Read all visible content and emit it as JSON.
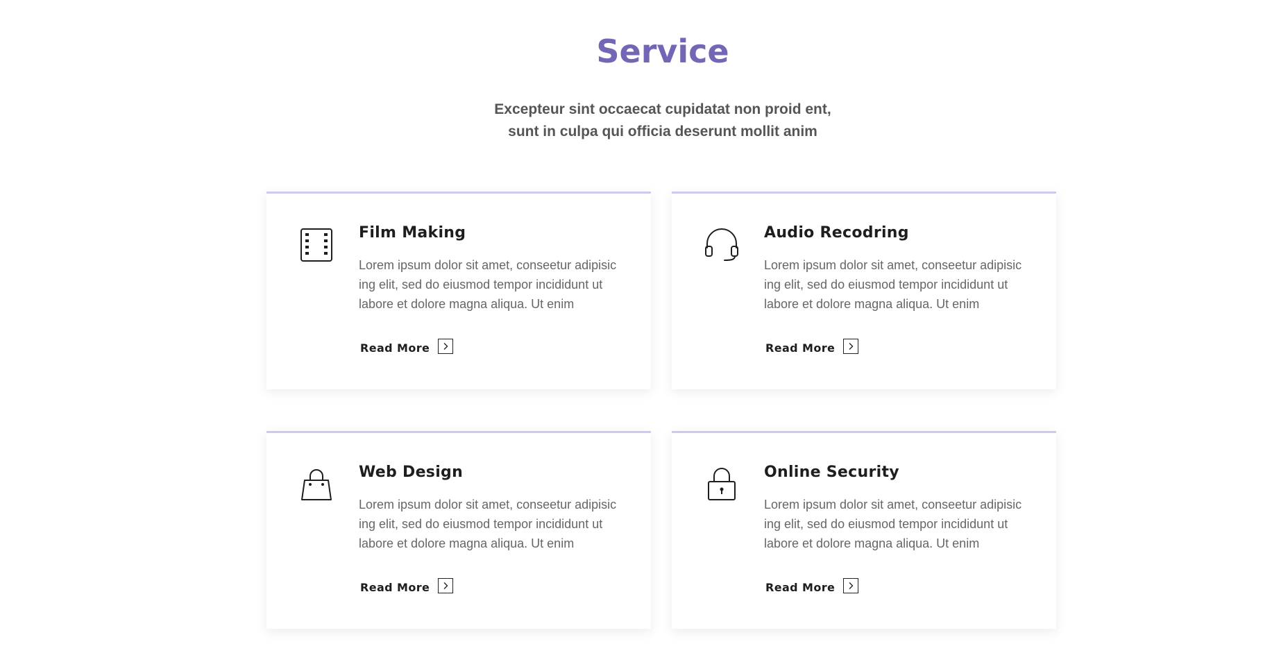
{
  "section": {
    "title": "Service",
    "subtitle": "Excepteur sint occaecat cupidatat non proid ent, sunt in culpa qui officia deserunt mollit anim"
  },
  "cards": [
    {
      "icon": "film-strip-icon",
      "title": "Film Making",
      "text": "Lorem ipsum dolor sit amet, conseetur adipisic ing elit, sed do eiusmod tempor incididunt ut labore et dolore magna aliqua. Ut enim",
      "link_label": "Read More"
    },
    {
      "icon": "headphones-icon",
      "title": "Audio Recodring",
      "text": "Lorem ipsum dolor sit amet, conseetur adipisic ing elit, sed do eiusmod tempor incididunt ut labore et dolore magna aliqua. Ut enim",
      "link_label": "Read More"
    },
    {
      "icon": "shopping-bag-icon",
      "title": "Web Design",
      "text": "Lorem ipsum dolor sit amet, conseetur adipisic ing elit, sed do eiusmod tempor incididunt ut labore et dolore magna aliqua. Ut enim",
      "link_label": "Read More"
    },
    {
      "icon": "padlock-icon",
      "title": "Online Security",
      "text": "Lorem ipsum dolor sit amet, conseetur adipisic ing elit, sed do eiusmod tempor incididunt ut labore et dolore magna aliqua. Ut enim",
      "link_label": "Read More"
    }
  ],
  "colors": {
    "accent": "#7266b5",
    "card_top_border": "#cfc9f1",
    "heading": "#1e1e1e",
    "body_text": "#666666"
  }
}
